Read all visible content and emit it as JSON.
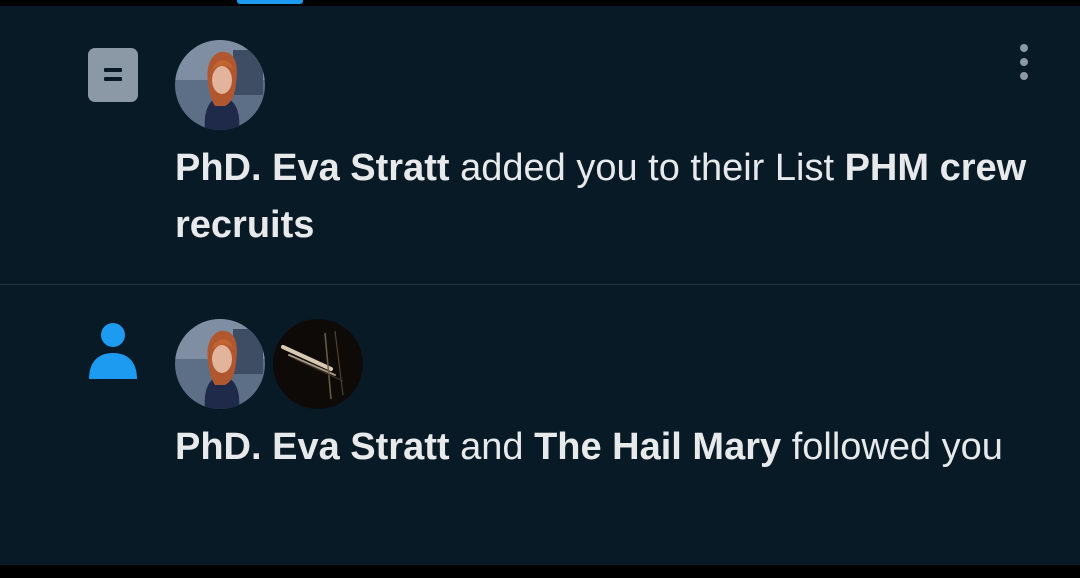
{
  "notifications": [
    {
      "type_icon": "list-icon",
      "actor_avatars": [
        "PhD. Eva Stratt"
      ],
      "text": {
        "actor": "PhD. Eva Stratt",
        "action": " added you to their List ",
        "object": "PHM crew recruits"
      },
      "more_icon": "more-vertical-icon"
    },
    {
      "type_icon": "person-icon",
      "actor_avatars": [
        "PhD. Eva Stratt",
        "The Hail Mary"
      ],
      "text": {
        "actor": "PhD. Eva Stratt",
        "conjunction": " and ",
        "actor2": "The Hail Mary",
        "action": " followed you"
      }
    }
  ],
  "colors": {
    "background": "#071a26",
    "text": "#e7e9ea",
    "accent": "#1d9bf0",
    "list_icon": "#8b98a5",
    "divider": "#253341"
  }
}
